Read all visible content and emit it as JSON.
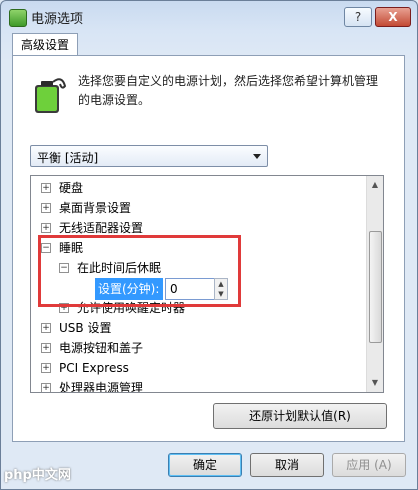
{
  "window": {
    "title": "电源选项",
    "help_label": "?",
    "close_label": "X"
  },
  "tab": {
    "label": "高级设置"
  },
  "intro": {
    "text": "选择您要自定义的电源计划，然后选择您希望计算机管理的电源设置。"
  },
  "plan_select": {
    "value": "平衡 [活动]"
  },
  "tree": {
    "items": [
      {
        "toggle": "+",
        "label": "硬盘"
      },
      {
        "toggle": "+",
        "label": "桌面背景设置"
      },
      {
        "toggle": "+",
        "label": "无线适配器设置"
      },
      {
        "toggle": "−",
        "label": "睡眠"
      },
      {
        "toggle": "−",
        "label": "在此时间后休眠"
      },
      {
        "toggle": "+",
        "label": "允许使用唤醒定时器"
      },
      {
        "toggle": "+",
        "label": "USB 设置"
      },
      {
        "toggle": "+",
        "label": "电源按钮和盖子"
      },
      {
        "toggle": "+",
        "label": "PCI Express"
      },
      {
        "toggle": "+",
        "label": "处理器电源管理"
      }
    ],
    "setting": {
      "label": "设置(分钟):",
      "value": "0"
    }
  },
  "buttons": {
    "restore": "还原计划默认值(R)",
    "ok": "确定",
    "cancel": "取消",
    "apply": "应用 (A)"
  },
  "watermark": {
    "text": "php中文网"
  },
  "colors": {
    "highlight_border": "#e03a3a",
    "selection_bg": "#3399ff"
  }
}
